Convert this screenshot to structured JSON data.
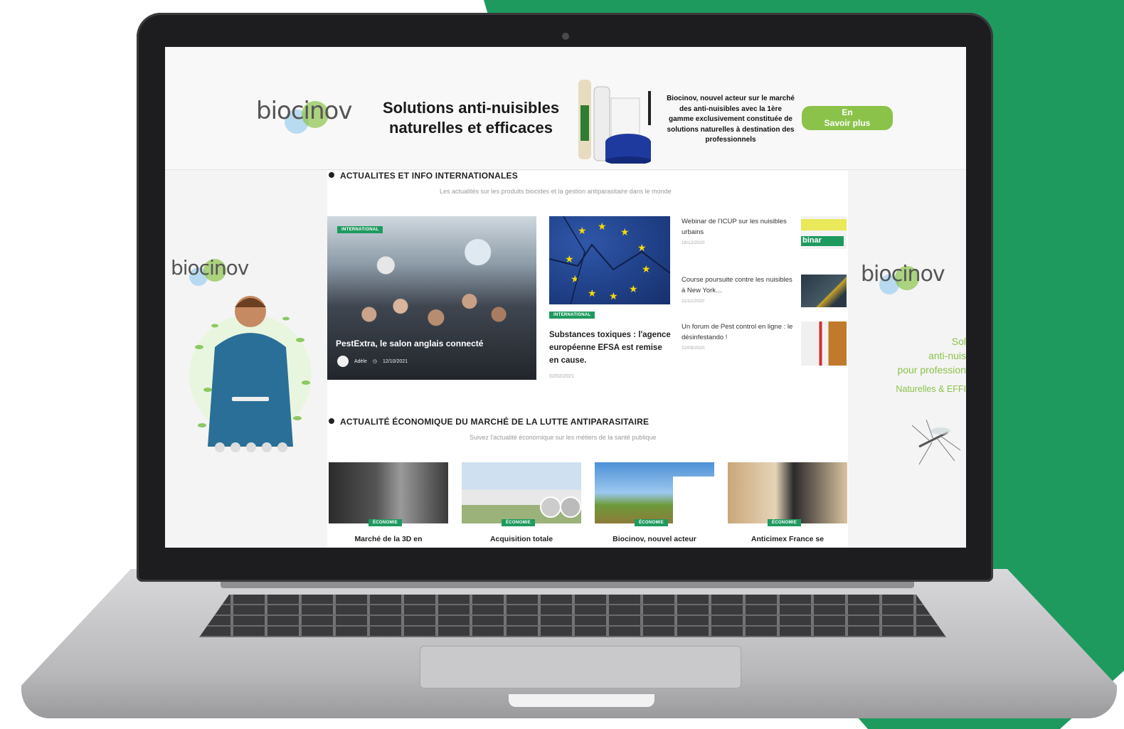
{
  "banner": {
    "brand": "biocinov",
    "title_line1": "Solutions anti-nuisibles",
    "title_line2": "naturelles et efficaces",
    "description": "Biocinov, nouvel acteur sur le marché des anti-nuisibles avec la 1ère gamme exclusivement constituée de solutions naturelles à destination des professionnels",
    "cta_line1": "En",
    "cta_line2": "Savoir plus"
  },
  "section_international": {
    "heading": "ACTUALITES ET INFO INTERNATIONALES",
    "subtitle": "Les actualités sur les produits biocides et la gestion antiparasitaire dans le monde",
    "featured": {
      "tag": "INTERNATIONAL",
      "title": "PestExtra, le salon anglais connecté",
      "author": "Adèle",
      "date": "12/10/2021"
    },
    "middle": {
      "tag": "INTERNATIONAL",
      "title": "Substances toxiques : l'agence européenne EFSA est remise en cause.",
      "date": "02/02/2021"
    },
    "side_items": [
      {
        "title": "Webinar de l'ICUP sur les nuisibles urbains",
        "date": "18/12/2020",
        "thumb_text": "binar"
      },
      {
        "title": "Course poursuite contre les nuisibles à New York…",
        "date": "11/12/2020"
      },
      {
        "title": "Un forum de Pest control en ligne : le désinfestando !",
        "date": "22/09/2020"
      }
    ]
  },
  "section_economy": {
    "heading": "ACTUALITÉ ÉCONOMIQUE DU MARCHÉ DE LA LUTTE ANTIPARASITAIRE",
    "subtitle": "Suivez l'actualité économique sur les métiers de la santé publique",
    "cards": [
      {
        "tag": "ÉCONOMIE",
        "title": "Marché de la 3D en"
      },
      {
        "tag": "ÉCONOMIE",
        "title": "Acquisition totale"
      },
      {
        "tag": "ÉCONOMIE",
        "title": "Biocinov, nouvel acteur"
      },
      {
        "tag": "ÉCONOMIE",
        "title": "Anticimex France se"
      }
    ]
  },
  "side_right": {
    "line1": "Sol",
    "line2": "anti-nuis",
    "line3": "pour profession",
    "line4": "Naturelles & EFFI"
  },
  "colors": {
    "brand_green": "#1f9a5f",
    "cta_green": "#8bc34a",
    "logo_blue": "#a9d3f0"
  }
}
